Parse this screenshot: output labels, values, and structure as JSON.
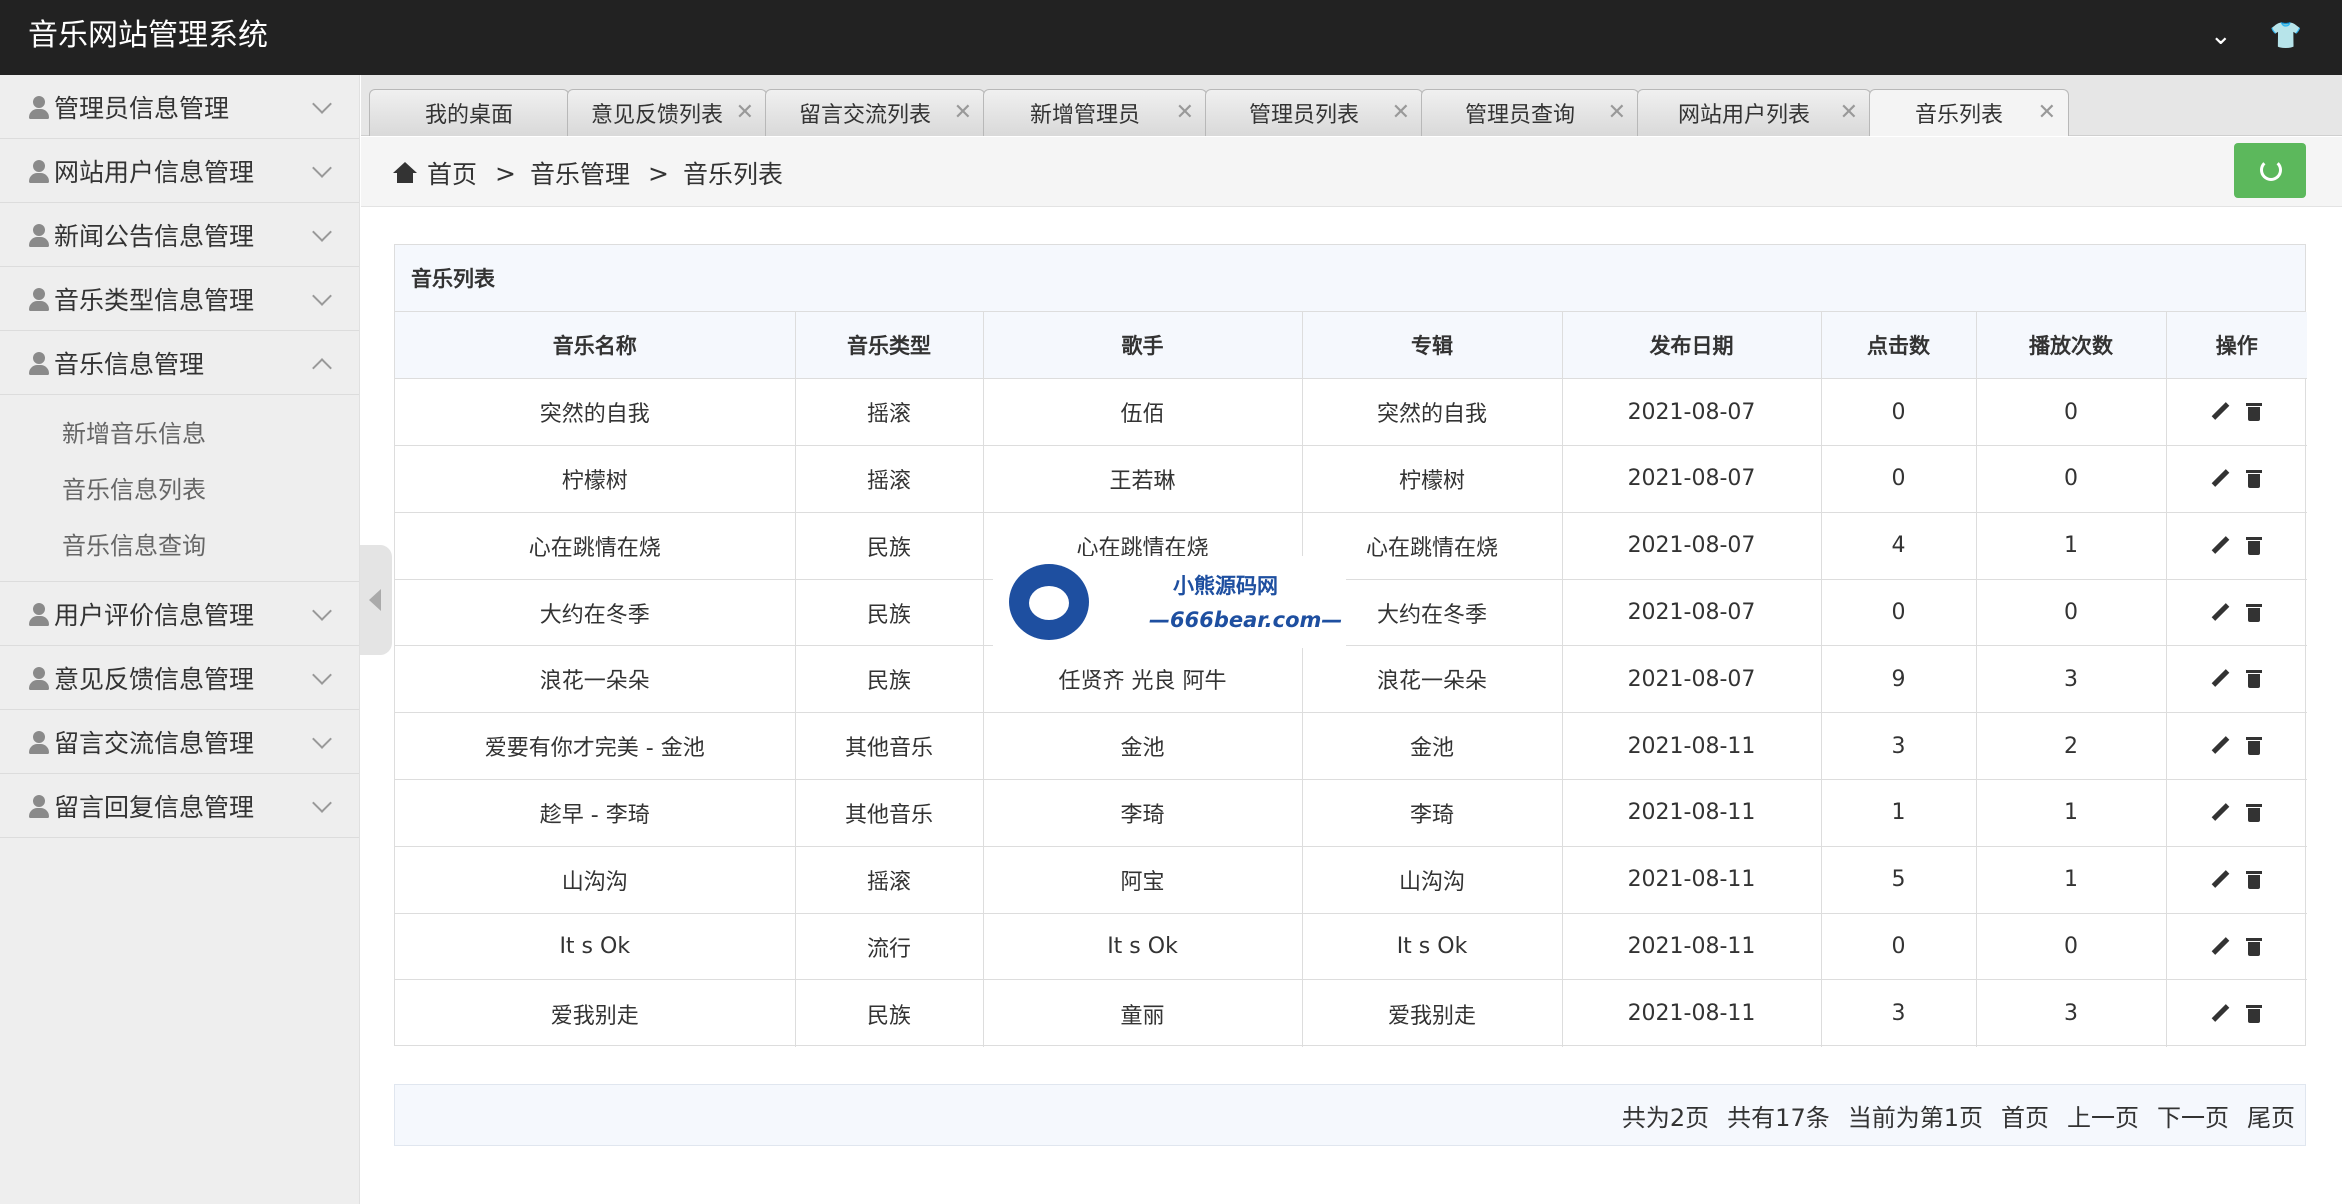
{
  "app": {
    "title": "音乐网站管理系统"
  },
  "topbar": {
    "dropdown_icon": "chevron-down-icon",
    "skin_icon": "tshirt-icon"
  },
  "sidebar": {
    "items": [
      {
        "label": "管理员信息管理",
        "expanded": false
      },
      {
        "label": "网站用户信息管理",
        "expanded": false
      },
      {
        "label": "新闻公告信息管理",
        "expanded": false
      },
      {
        "label": "音乐类型信息管理",
        "expanded": false
      },
      {
        "label": "音乐信息管理",
        "expanded": true
      },
      {
        "label": "用户评价信息管理",
        "expanded": false
      },
      {
        "label": "意见反馈信息管理",
        "expanded": false
      },
      {
        "label": "留言交流信息管理",
        "expanded": false
      },
      {
        "label": "留言回复信息管理",
        "expanded": false
      }
    ],
    "submenu": [
      "新增音乐信息",
      "音乐信息列表",
      "音乐信息查询"
    ]
  },
  "tabs": [
    {
      "label": "我的桌面",
      "closable": false
    },
    {
      "label": "意见反馈列表",
      "closable": true
    },
    {
      "label": "留言交流列表",
      "closable": true
    },
    {
      "label": "新增管理员",
      "closable": true
    },
    {
      "label": "管理员列表",
      "closable": true
    },
    {
      "label": "管理员查询",
      "closable": true
    },
    {
      "label": "网站用户列表",
      "closable": true
    },
    {
      "label": "音乐列表",
      "closable": true,
      "active": true
    }
  ],
  "tab_close_symbol": "✕",
  "breadcrumb": {
    "home": "首页",
    "sep": ">",
    "level1": "音乐管理",
    "level2": "音乐列表"
  },
  "panel": {
    "title": "音乐列表",
    "columns": [
      "音乐名称",
      "音乐类型",
      "歌手",
      "专辑",
      "发布日期",
      "点击数",
      "播放次数",
      "操作"
    ],
    "rows": [
      [
        "突然的自我",
        "摇滚",
        "伍佰",
        "突然的自我",
        "2021-08-07",
        "0",
        "0"
      ],
      [
        "柠檬树",
        "摇滚",
        "王若琳",
        "柠檬树",
        "2021-08-07",
        "0",
        "0"
      ],
      [
        "心在跳情在烧",
        "民族",
        "心在跳情在烧",
        "心在跳情在烧",
        "2021-08-07",
        "4",
        "1"
      ],
      [
        "大约在冬季",
        "民族",
        "",
        "大约在冬季",
        "2021-08-07",
        "0",
        "0"
      ],
      [
        "浪花一朵朵",
        "民族",
        "任贤齐 光良 阿牛",
        "浪花一朵朵",
        "2021-08-07",
        "9",
        "3"
      ],
      [
        "爱要有你才完美 - 金池",
        "其他音乐",
        "金池",
        "金池",
        "2021-08-11",
        "3",
        "2"
      ],
      [
        "趁早 - 李琦",
        "其他音乐",
        "李琦",
        "李琦",
        "2021-08-11",
        "1",
        "1"
      ],
      [
        "山沟沟",
        "摇滚",
        "阿宝",
        "山沟沟",
        "2021-08-11",
        "5",
        "1"
      ],
      [
        "It s Ok",
        "流行",
        "It s Ok",
        "It s Ok",
        "2021-08-11",
        "0",
        "0"
      ],
      [
        "爱我别走",
        "民族",
        "童丽",
        "爱我别走",
        "2021-08-11",
        "3",
        "3"
      ]
    ]
  },
  "pager": {
    "total_pages": "共为2页",
    "total_records": "共有17条",
    "current": "当前为第1页",
    "first": "首页",
    "prev": "上一页",
    "next": "下一页",
    "last": "尾页"
  },
  "watermark": {
    "line1": "小熊源码网",
    "line2": "—666bear.com—"
  },
  "colors": {
    "topbar": "#222222",
    "sidebar": "#eeeeee",
    "refresh_button": "#5cb85c",
    "table_header": "#f5f8fd"
  }
}
